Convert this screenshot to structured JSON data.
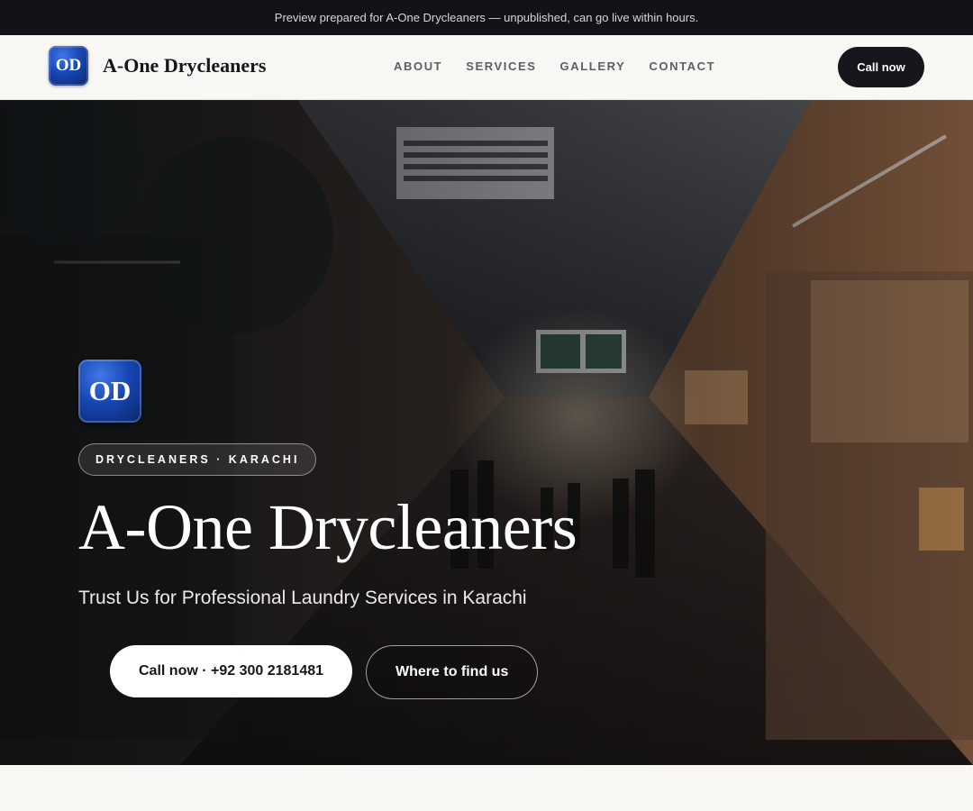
{
  "banner": {
    "text": "Preview prepared for A-One Drycleaners — unpublished, can go live within hours."
  },
  "header": {
    "logo_text": "OD",
    "brand_name": "A-One Drycleaners",
    "nav": [
      {
        "label": "ABOUT"
      },
      {
        "label": "SERVICES"
      },
      {
        "label": "GALLERY"
      },
      {
        "label": "CONTACT"
      }
    ],
    "cta_label": "Call now"
  },
  "hero": {
    "logo_text": "OD",
    "tag": "DRYCLEANERS · KARACHI",
    "title": "A-One Drycleaners",
    "subtitle": "Trust Us for Professional Laundry Services in Karachi",
    "primary_button": "Call now · +92 300 2181481",
    "secondary_button": "Where to find us"
  }
}
